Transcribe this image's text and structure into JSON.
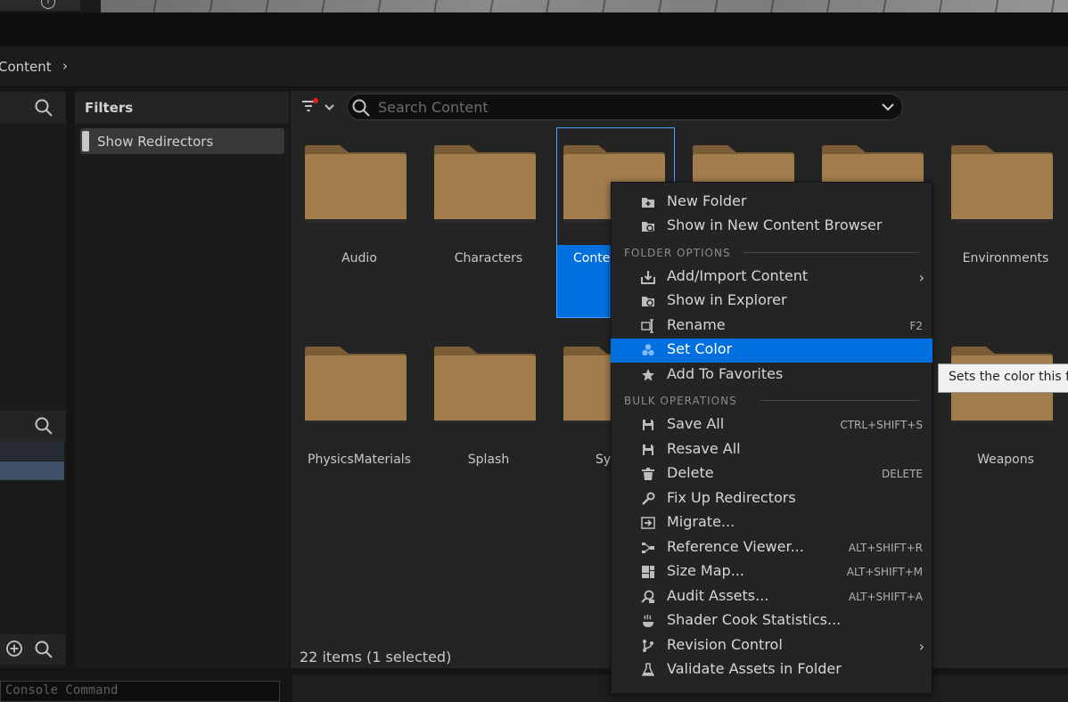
{
  "breadcrumb": {
    "item": "Content"
  },
  "filters": {
    "title": "Filters",
    "items": [
      {
        "label": "Show Redirectors"
      }
    ]
  },
  "search": {
    "placeholder": "Search Content"
  },
  "folders": [
    {
      "label": "Audio"
    },
    {
      "label": "Characters"
    },
    {
      "label": "Conte"
    },
    {
      "label": ""
    },
    {
      "label": ""
    },
    {
      "label": "Environments"
    },
    {
      "label": "PhysicsMaterials"
    },
    {
      "label": "Splash"
    },
    {
      "label": "Sy"
    },
    {
      "label": "Weapons"
    }
  ],
  "status": {
    "item_count": "22 items (1 selected)"
  },
  "console": {
    "placeholder": "Console Command"
  },
  "context_menu": {
    "items": [
      {
        "label": "New Folder",
        "icon": "new-folder-icon"
      },
      {
        "label": "Show in New Content Browser",
        "icon": "browse-folder-icon"
      }
    ],
    "folder_options_header": "FOLDER OPTIONS",
    "folder_options": [
      {
        "label": "Add/Import Content",
        "icon": "import-icon",
        "submenu": "›"
      },
      {
        "label": "Show in Explorer",
        "icon": "explorer-icon"
      },
      {
        "label": "Rename",
        "icon": "rename-icon",
        "shortcut": "F2"
      },
      {
        "label": "Set Color",
        "icon": "color-icon"
      },
      {
        "label": "Add To Favorites",
        "icon": "star-icon"
      }
    ],
    "bulk_header": "BULK OPERATIONS",
    "bulk": [
      {
        "label": "Save All",
        "icon": "save-icon",
        "shortcut": "CTRL+SHIFT+S"
      },
      {
        "label": "Resave All",
        "icon": "save-icon"
      },
      {
        "label": "Delete",
        "icon": "trash-icon",
        "shortcut": "DELETE"
      },
      {
        "label": "Fix Up Redirectors",
        "icon": "wrench-icon"
      },
      {
        "label": "Migrate...",
        "icon": "migrate-icon"
      },
      {
        "label": "Reference Viewer...",
        "icon": "reference-icon",
        "shortcut": "ALT+SHIFT+R"
      },
      {
        "label": "Size Map...",
        "icon": "sizemap-icon",
        "shortcut": "ALT+SHIFT+M"
      },
      {
        "label": "Audit Assets...",
        "icon": "audit-icon",
        "shortcut": "ALT+SHIFT+A"
      },
      {
        "label": "Shader Cook Statistics...",
        "icon": "shader-icon"
      },
      {
        "label": "Revision Control",
        "icon": "branch-icon",
        "submenu": "›"
      },
      {
        "label": "Validate Assets in Folder",
        "icon": "flask-icon"
      }
    ]
  },
  "tooltip": {
    "text": "Sets the color this f"
  },
  "colors": {
    "accent": "#0070e0",
    "folder": "#a27d4e"
  }
}
